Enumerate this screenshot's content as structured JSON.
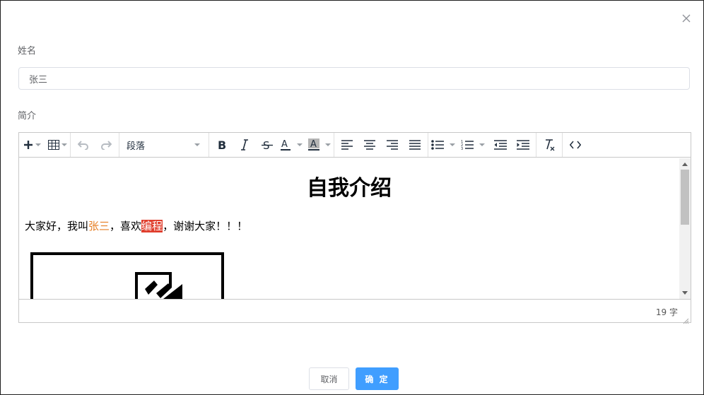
{
  "form": {
    "name_label": "姓名",
    "name_value": "张三",
    "intro_label": "简介"
  },
  "editor": {
    "toolbar": {
      "block_format": "段落"
    },
    "content": {
      "heading": "自我介绍",
      "para_part1": "大家好，我叫",
      "para_highlight_name": "张三",
      "para_part2": "，喜欢",
      "para_highlight_hobby": "编程",
      "para_part3": "，谢谢大家！！！"
    },
    "status": {
      "word_count": "19 字"
    }
  },
  "footer": {
    "cancel_label": "取消",
    "confirm_label": "确 定"
  },
  "colors": {
    "primary": "#409eff",
    "highlight_text": "#e67e23",
    "highlight_bg": "#e03e2d"
  },
  "icons": [
    "close-icon",
    "insert-icon",
    "table-icon",
    "undo-icon",
    "redo-icon",
    "bold-icon",
    "italic-icon",
    "strikethrough-icon",
    "text-color-icon",
    "background-color-icon",
    "align-left-icon",
    "align-center-icon",
    "align-right-icon",
    "align-justify-icon",
    "bullet-list-icon",
    "numbered-list-icon",
    "outdent-icon",
    "indent-icon",
    "clear-formatting-icon",
    "source-code-icon",
    "image-placeholder-icon",
    "resize-handle-icon"
  ]
}
